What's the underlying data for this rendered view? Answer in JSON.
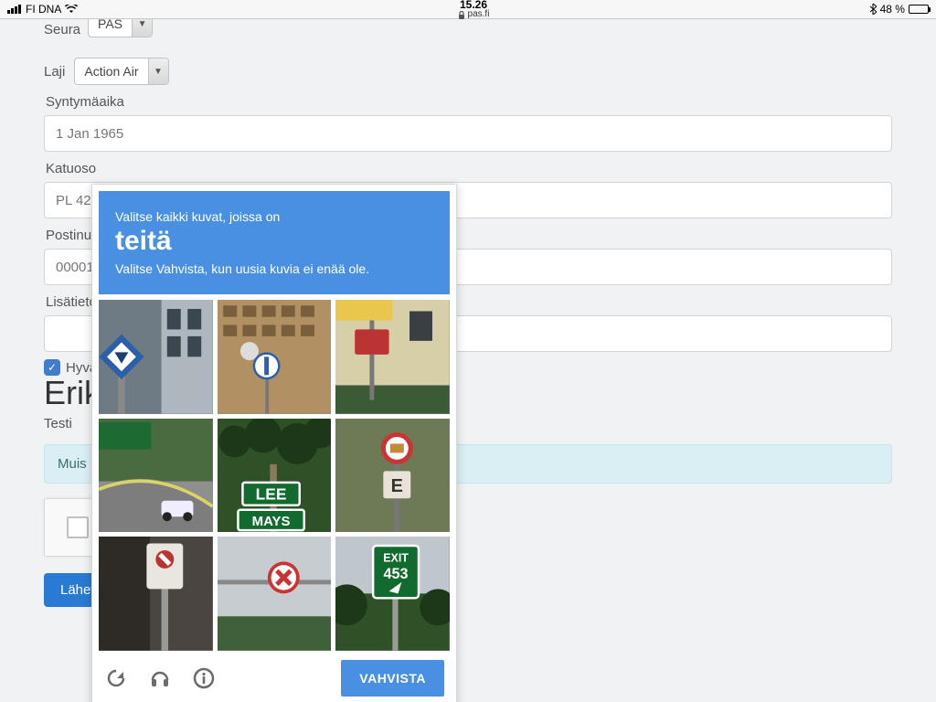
{
  "statusbar": {
    "carrier": "FI DNA",
    "time": "15.26",
    "url": "pas.fi",
    "battery_pct": "48 %",
    "battery_fill": 48
  },
  "form": {
    "seura_label_cut": "Seura",
    "seura_value_cut": "PAS",
    "laji_label": "Laji",
    "laji_value": "Action Air",
    "synt_label": "Syntymäaika",
    "synt_value": "1 Jan 1965",
    "katu_label_cut": "Katuoso",
    "katu_value": "PL 42",
    "postinro_label_cut": "Postinur",
    "postinro_value": "00001",
    "lisa_label_cut": "Lisätieto",
    "lisa_value": "",
    "check_label_cut": "Hyvä",
    "erik_cut": "Erik",
    "testi": "Testi",
    "banner_cut": "Muis",
    "submit_cut": "Lähet"
  },
  "captcha": {
    "line1": "Valitse kaikki kuvat, joissa on",
    "target": "teitä",
    "line3": "Valitse Vahvista, kun uusia kuvia ei enää ole.",
    "verify": "VAHVISTA",
    "tiles": [
      {
        "name": "tile-crosswalk-sign"
      },
      {
        "name": "tile-apartment-crosswalk"
      },
      {
        "name": "tile-red-warning-sign"
      },
      {
        "name": "tile-curved-road"
      },
      {
        "name": "tile-lee-road-sign"
      },
      {
        "name": "tile-circular-sign-e"
      },
      {
        "name": "tile-parking-sign"
      },
      {
        "name": "tile-no-entry-sign"
      },
      {
        "name": "tile-exit-453"
      }
    ],
    "exit_text1": "EXIT",
    "exit_text2": "453",
    "lee_text": "LEE",
    "mays_text": "MAYS"
  }
}
